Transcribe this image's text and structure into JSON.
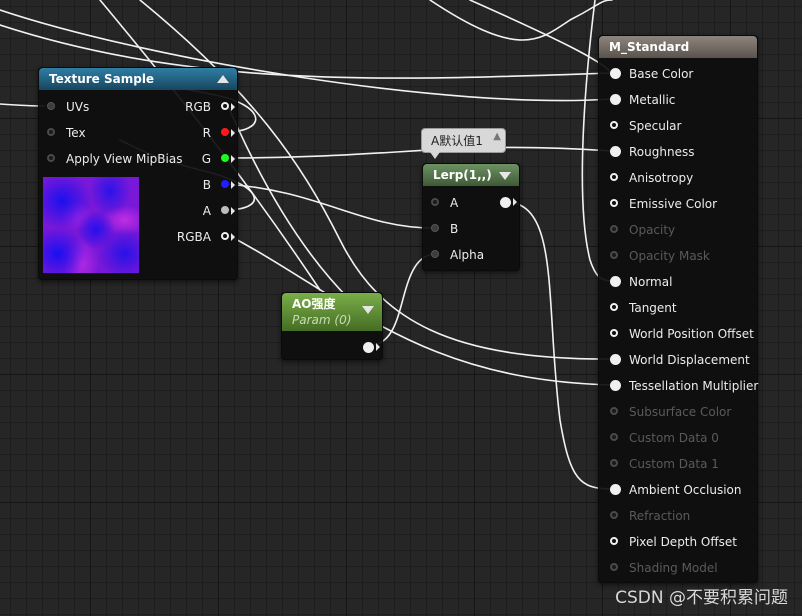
{
  "texture_sample": {
    "title": "Texture Sample",
    "inputs": [
      "UVs",
      "Tex",
      "Apply View MipBias"
    ],
    "outputs": [
      "RGB",
      "R",
      "G",
      "B",
      "A",
      "RGBA"
    ]
  },
  "lerp": {
    "title": "Lerp(1,,)",
    "inputs": [
      "A",
      "B",
      "Alpha"
    ],
    "tooltip": "A默认值1"
  },
  "ao_param": {
    "title": "AO强度",
    "subtitle": "Param (0)"
  },
  "material": {
    "title": "M_Standard",
    "pins": [
      {
        "label": "Base Color",
        "connected": true,
        "enabled": true
      },
      {
        "label": "Metallic",
        "connected": true,
        "enabled": true
      },
      {
        "label": "Specular",
        "connected": false,
        "enabled": true
      },
      {
        "label": "Roughness",
        "connected": true,
        "enabled": true
      },
      {
        "label": "Anisotropy",
        "connected": false,
        "enabled": true
      },
      {
        "label": "Emissive Color",
        "connected": false,
        "enabled": true
      },
      {
        "label": "Opacity",
        "connected": false,
        "enabled": false
      },
      {
        "label": "Opacity Mask",
        "connected": false,
        "enabled": false
      },
      {
        "label": "Normal",
        "connected": true,
        "enabled": true
      },
      {
        "label": "Tangent",
        "connected": false,
        "enabled": true
      },
      {
        "label": "World Position Offset",
        "connected": false,
        "enabled": true
      },
      {
        "label": "World Displacement",
        "connected": true,
        "enabled": true
      },
      {
        "label": "Tessellation Multiplier",
        "connected": true,
        "enabled": true
      },
      {
        "label": "Subsurface Color",
        "connected": false,
        "enabled": false
      },
      {
        "label": "Custom Data 0",
        "connected": false,
        "enabled": false
      },
      {
        "label": "Custom Data 1",
        "connected": false,
        "enabled": false
      },
      {
        "label": "Ambient Occlusion",
        "connected": true,
        "enabled": true
      },
      {
        "label": "Refraction",
        "connected": false,
        "enabled": false
      },
      {
        "label": "Pixel Depth Offset",
        "connected": false,
        "enabled": true
      },
      {
        "label": "Shading Model",
        "connected": false,
        "enabled": false
      }
    ]
  },
  "colors": {
    "texture_header": "#1e5a78",
    "lerp_header": "#4f6f46",
    "param_header": "#5a8a30",
    "material_header": "#6e6660",
    "pin_r": "#ff1a1a",
    "pin_g": "#19ff19",
    "pin_b": "#2020ff",
    "wire": "#ffffff"
  },
  "watermark": "CSDN @不要积累问题"
}
